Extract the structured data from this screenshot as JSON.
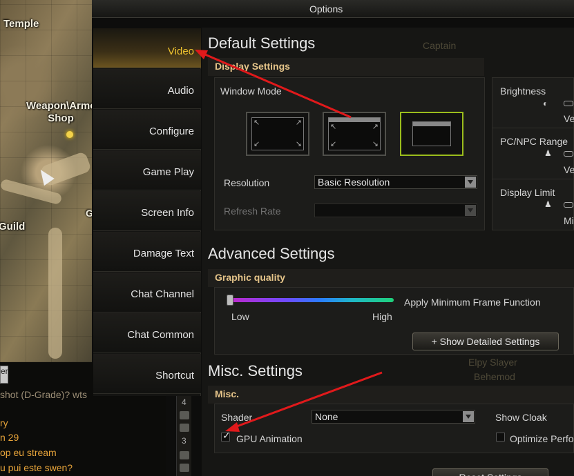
{
  "window": {
    "title": "Options"
  },
  "map": {
    "labels": {
      "temple": "Temple",
      "shop_line1": "Weapon\\Armor",
      "shop_line2": "Shop",
      "guild": "Guild",
      "grocery": "Grocery"
    }
  },
  "chat": {
    "button_label": "er",
    "lines": [
      "shot (D-Grade)? wts",
      "ry",
      "n 29",
      "op eu stream",
      "u pui este swen?"
    ],
    "scroll_numbers": [
      "4",
      "3"
    ]
  },
  "menu": {
    "items": [
      {
        "label": "Video",
        "active": true
      },
      {
        "label": "Audio"
      },
      {
        "label": "Configure"
      },
      {
        "label": "Game Play"
      },
      {
        "label": "Screen Info"
      },
      {
        "label": "Damage Text"
      },
      {
        "label": "Chat Channel"
      },
      {
        "label": "Chat Common"
      },
      {
        "label": "Shortcut"
      }
    ]
  },
  "default_settings": {
    "title": "Default Settings",
    "display_header": "Display Settings",
    "window_mode_label": "Window Mode",
    "resolution_label": "Resolution",
    "resolution_value": "Basic Resolution",
    "refresh_rate_label": "Refresh Rate",
    "refresh_rate_value": "",
    "brightness_label": "Brightness",
    "brightness_value": "Ve",
    "pcnpc_label": "PC/NPC Range",
    "pcnpc_value": "Ve",
    "display_limit_label": "Display Limit",
    "display_limit_value": "Mi"
  },
  "advanced_settings": {
    "title": "Advanced Settings",
    "graphic_header": "Graphic quality",
    "low_label": "Low",
    "high_label": "High",
    "min_frame_label": "Apply Minimum Frame Function",
    "show_detailed_button": "+ Show Detailed Settings"
  },
  "misc_settings": {
    "title": "Misc. Settings",
    "misc_header": "Misc.",
    "shader_label": "Shader",
    "shader_value": "None",
    "show_cloak_label": "Show Cloak",
    "gpu_animation_label": "GPU Animation",
    "gpu_animation_checked": true,
    "optimize_label": "Optimize Perfo",
    "optimize_checked": false,
    "reset_button": "Reset Settings"
  },
  "background_text": {
    "captain": "Captain",
    "elpy_slayer": "Elpy Slayer",
    "behemod": "Behemod"
  },
  "colors": {
    "active_menu_text": "#f1c52f",
    "selected_mode_border": "#9bbd1c",
    "annotation_arrow": "#e0191b"
  }
}
